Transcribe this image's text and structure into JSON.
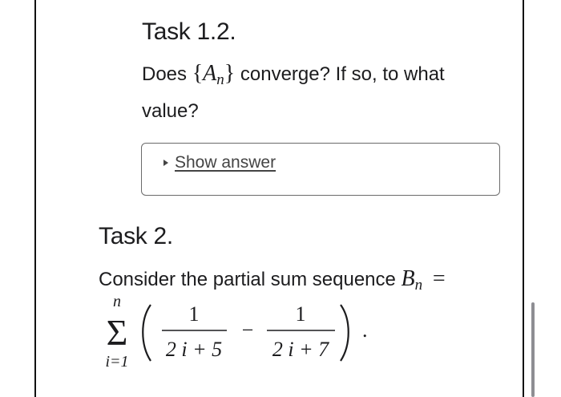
{
  "subtask": {
    "title": "Task 1.2.",
    "question_prefix": "Does",
    "sequence_open": "{",
    "sequence_var": "A",
    "sequence_sub": "n",
    "sequence_close": "}",
    "question_suffix": "converge? If so, to what value?",
    "answer_toggle_label": "Show answer"
  },
  "task": {
    "title": "Task 2.",
    "statement_text": "Consider the partial sum sequence",
    "statement_var": "B",
    "statement_sub": "n",
    "statement_equals": "=",
    "formula": {
      "sum_upper": "n",
      "sum_lower": "i=1",
      "sigma": "Σ",
      "term1_num": "1",
      "term1_den": "2 i + 5",
      "minus": "−",
      "term2_num": "1",
      "term2_den": "2 i + 7",
      "period": "."
    }
  },
  "icons": {
    "answer_toggle": "disclosure-triangle-icon"
  }
}
